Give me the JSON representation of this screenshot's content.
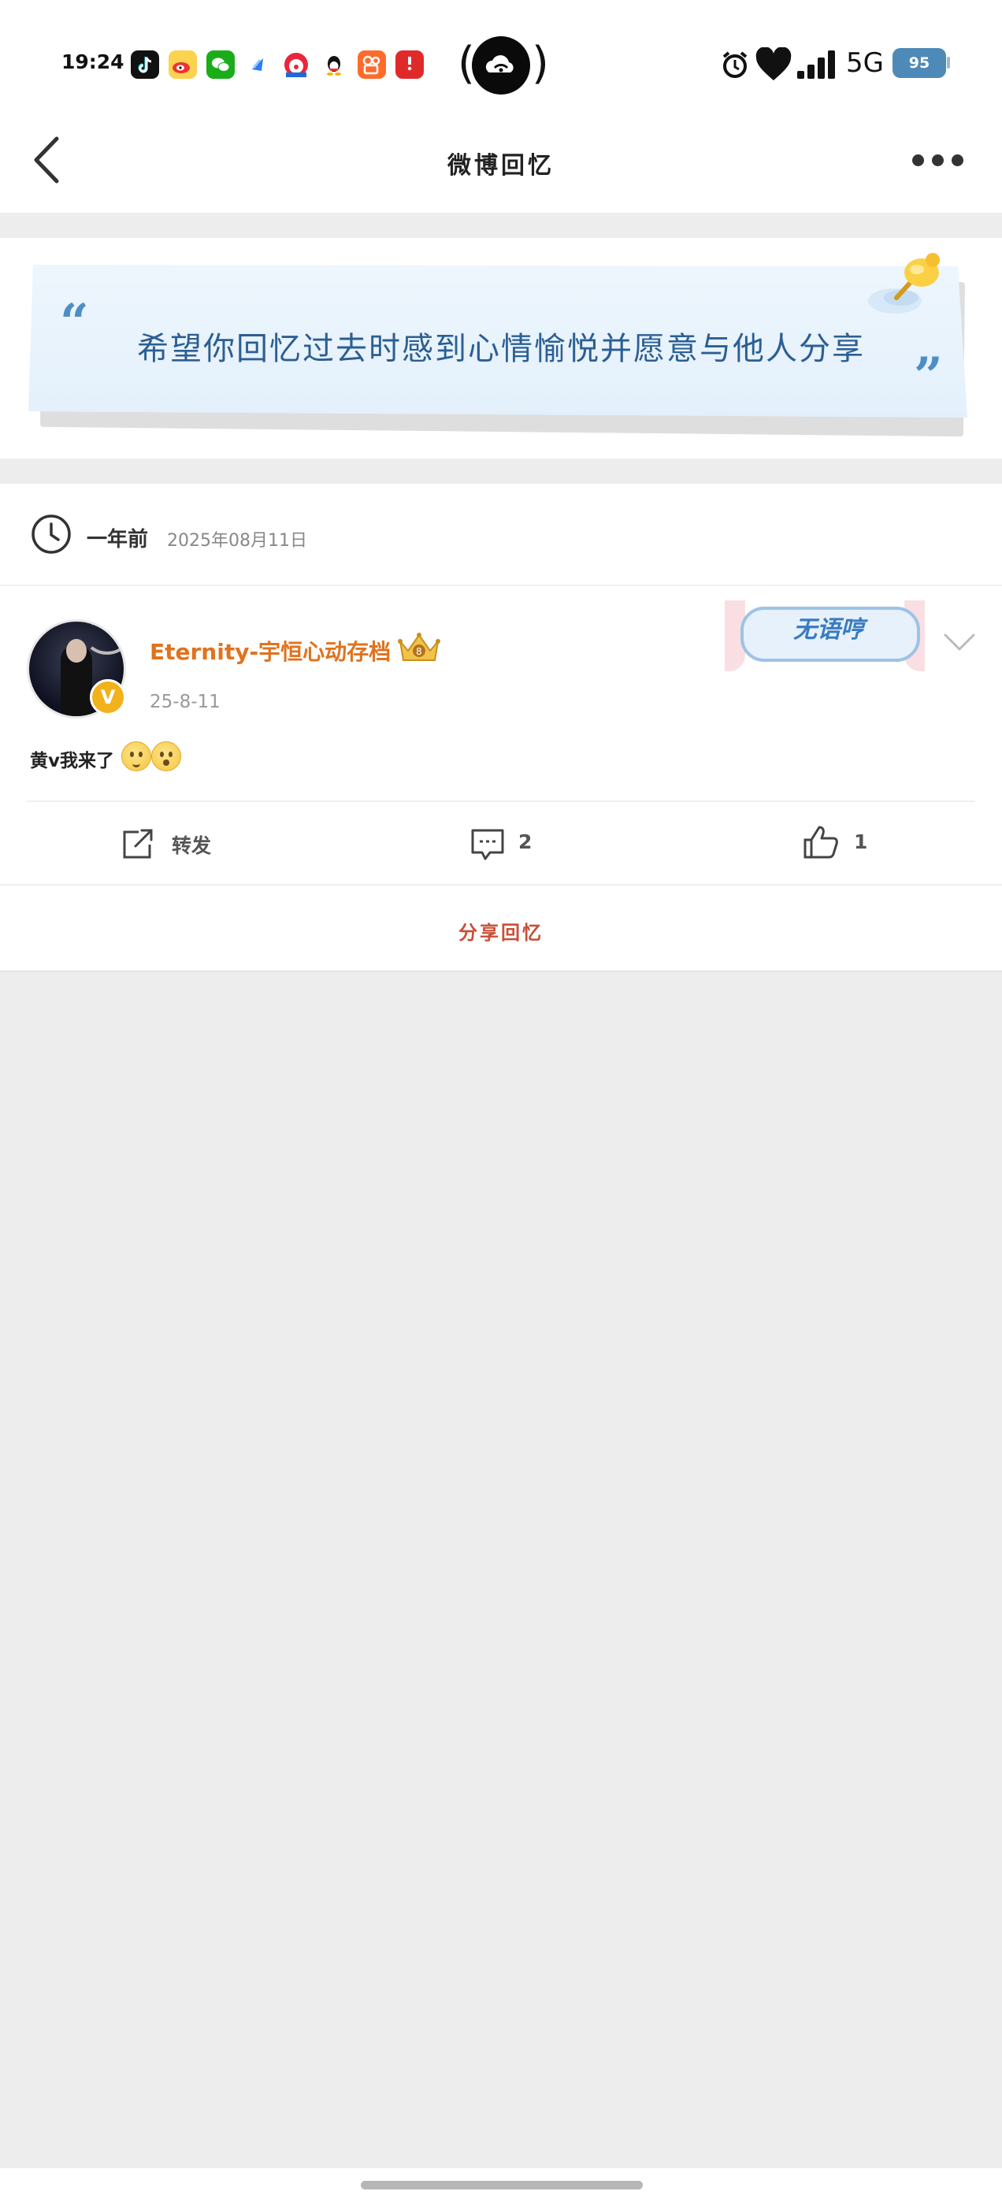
{
  "status_bar": {
    "time": "19:24",
    "network": "5G",
    "battery": "95",
    "app_icons": [
      "tiktok-icon",
      "weibo-icon",
      "wechat-icon",
      "browser-icon",
      "clown-app-icon",
      "qq-icon",
      "kuaishou-icon",
      "red-app-icon"
    ]
  },
  "nav": {
    "title": "微博回忆"
  },
  "banner": {
    "quote_open": "“",
    "text": "希望你回忆过去时感到心情愉悦并愿意与他人分享",
    "quote_close": "”"
  },
  "memory": {
    "ago": "一年前",
    "date": "2025年08月11日"
  },
  "post": {
    "username": "Eternity-宇恒心动存档",
    "verified": "V",
    "date": "25-8-11",
    "text": "黄v我来了",
    "sticker_text": "无语哼",
    "actions": {
      "repost_label": "转发",
      "comment_count": "2",
      "like_count": "1"
    },
    "share_label": "分享回忆"
  },
  "colors": {
    "username": "#e0731e",
    "banner_text": "#2c5f93",
    "share": "#c74f37",
    "badge": "#f2b21b"
  }
}
